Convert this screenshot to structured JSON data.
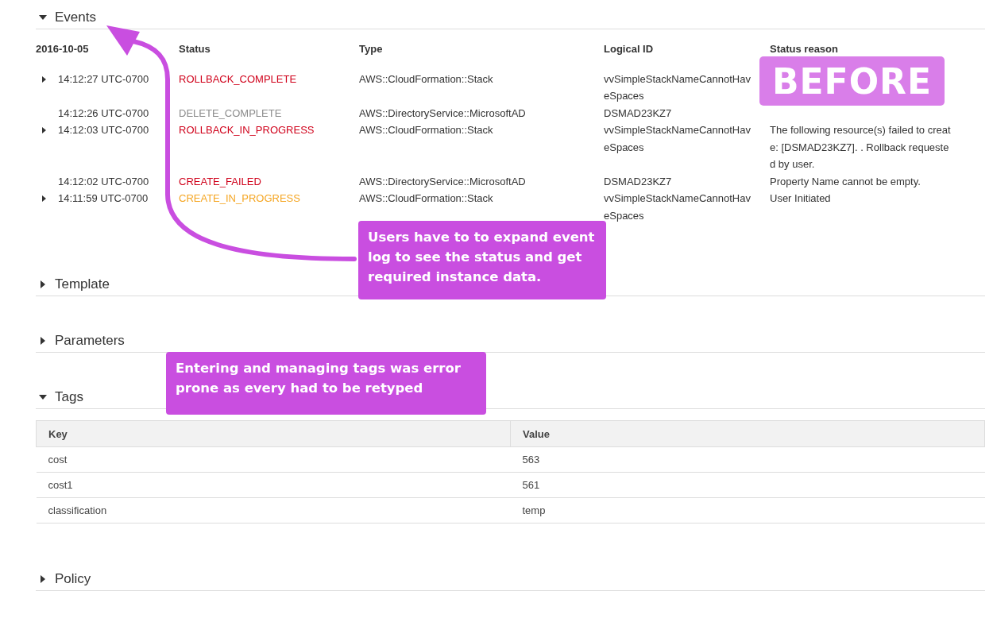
{
  "sections": [
    {
      "kind": "events",
      "title": "Events",
      "expanded": true,
      "date": "2016-10-05",
      "columns": [
        "Status",
        "Type",
        "Logical ID",
        "Status reason"
      ],
      "events": [
        {
          "expandable": true,
          "time": "14:12:27 UTC-0700",
          "status": "ROLLBACK_COMPLETE",
          "color": "#d0021b",
          "type": "AWS::CloudFormation::Stack",
          "logical_id": "vvSimpleStackNameCannotHaveSpaces"
        },
        {
          "expandable": false,
          "time": "14:12:26 UTC-0700",
          "status": "DELETE_COMPLETE",
          "color": "#8c8c8c",
          "type": "AWS::DirectoryService::MicrosoftAD",
          "logical_id": "DSMAD23KZ7"
        },
        {
          "expandable": true,
          "time": "14:12:03 UTC-0700",
          "status": "ROLLBACK_IN_PROGRESS",
          "color": "#d0021b",
          "type": "AWS::CloudFormation::Stack",
          "logical_id": "vvSimpleStackNameCannotHaveSpaces",
          "reason": "The following resource(s) failed to create: [DSMAD23KZ7]. . Rollback requested by user."
        },
        {
          "expandable": false,
          "time": "14:12:02 UTC-0700",
          "status": "CREATE_FAILED",
          "color": "#d0021b",
          "type": "AWS::DirectoryService::MicrosoftAD",
          "logical_id": "DSMAD23KZ7",
          "reason": "Property Name cannot be empty."
        },
        {
          "expandable": true,
          "time": "14:11:59 UTC-0700",
          "status": "CREATE_IN_PROGRESS",
          "color": "#f5a623",
          "type": "AWS::CloudFormation::Stack",
          "logical_id": "vvSimpleStackNameCannotHaveSpaces",
          "reason": "User Initiated"
        }
      ]
    },
    {
      "title": "Template",
      "expanded": false
    },
    {
      "title": "Parameters",
      "expanded": false
    },
    {
      "kind": "tags",
      "title": "Tags",
      "expanded": true,
      "columns": [
        "Key",
        "Value"
      ],
      "rows": [
        [
          "cost",
          "563"
        ],
        [
          "cost1",
          "561"
        ],
        [
          "classification",
          "temp"
        ]
      ]
    },
    {
      "title": "Policy",
      "expanded": false
    }
  ],
  "badge": "BEFORE",
  "callouts": [
    "Users have to to expand event log to see the status and get required instance data.",
    "Entering and managing tags was error prone as every had to be retyped"
  ]
}
